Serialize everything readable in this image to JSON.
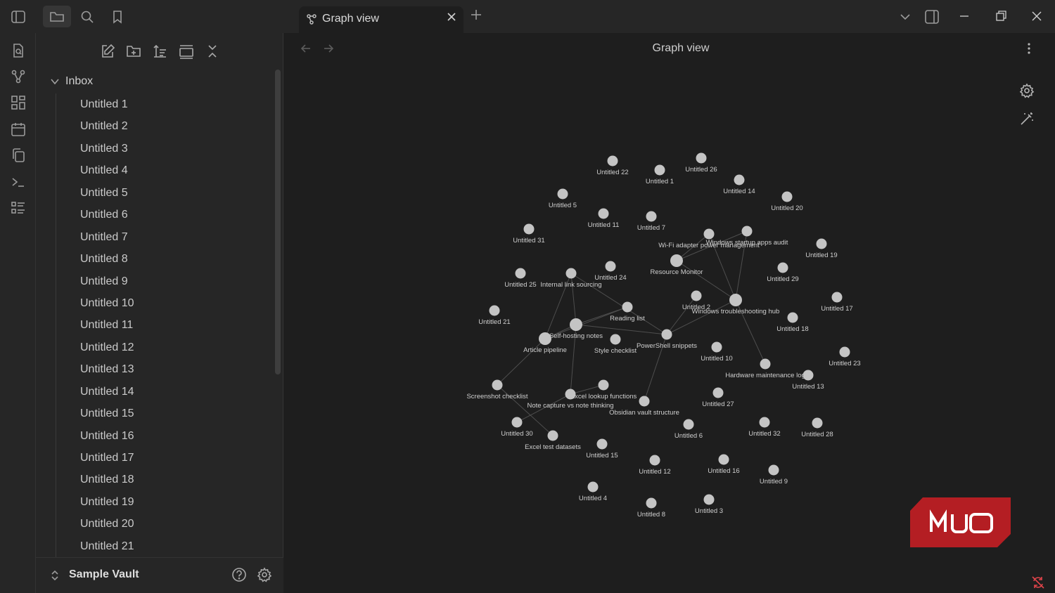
{
  "app": {
    "tab_title": "Graph view",
    "view_title": "Graph view"
  },
  "sidebar": {
    "folder_name": "Inbox",
    "files": [
      "Untitled 1",
      "Untitled 2",
      "Untitled 3",
      "Untitled 4",
      "Untitled 5",
      "Untitled 6",
      "Untitled 7",
      "Untitled 8",
      "Untitled 9",
      "Untitled 10",
      "Untitled 11",
      "Untitled 12",
      "Untitled 13",
      "Untitled 14",
      "Untitled 15",
      "Untitled 16",
      "Untitled 17",
      "Untitled 18",
      "Untitled 19",
      "Untitled 20",
      "Untitled 21"
    ],
    "vault_name": "Sample Vault"
  },
  "graph": {
    "nodes": [
      {
        "label": "Untitled 22"
      },
      {
        "label": "Untitled 26"
      },
      {
        "label": "Untitled 1"
      },
      {
        "label": "Untitled 14"
      },
      {
        "label": "Untitled 20"
      },
      {
        "label": "Untitled 5"
      },
      {
        "label": "Untitled 11"
      },
      {
        "label": "Untitled 7"
      },
      {
        "label": "Untitled 31"
      },
      {
        "label": "Wi-Fi adapter power management"
      },
      {
        "label": "Windows startup apps audit"
      },
      {
        "label": "Untitled 19"
      },
      {
        "label": "Resource Monitor"
      },
      {
        "label": "Untitled 29"
      },
      {
        "label": "Untitled 25"
      },
      {
        "label": "Internal link sourcing"
      },
      {
        "label": "Untitled 24"
      },
      {
        "label": "Untitled 2"
      },
      {
        "label": "Windows troubleshooting hub"
      },
      {
        "label": "Untitled 17"
      },
      {
        "label": "Untitled 21"
      },
      {
        "label": "Reading list"
      },
      {
        "label": "Untitled 18"
      },
      {
        "label": "Self-hosting notes"
      },
      {
        "label": "Article pipeline"
      },
      {
        "label": "Style checklist"
      },
      {
        "label": "PowerShell snippets"
      },
      {
        "label": "Untitled 10"
      },
      {
        "label": "Untitled 23"
      },
      {
        "label": "Hardware maintenance log"
      },
      {
        "label": "Untitled 13"
      },
      {
        "label": "Screenshot checklist"
      },
      {
        "label": "Excel lookup functions"
      },
      {
        "label": "Note capture vs note thinking"
      },
      {
        "label": "Obsidian vault structure"
      },
      {
        "label": "Untitled 27"
      },
      {
        "label": "Untitled 30"
      },
      {
        "label": "Untitled 6"
      },
      {
        "label": "Untitled 32"
      },
      {
        "label": "Untitled 28"
      },
      {
        "label": "Excel test datasets"
      },
      {
        "label": "Untitled 15"
      },
      {
        "label": "Untitled 12"
      },
      {
        "label": "Untitled 16"
      },
      {
        "label": "Untitled 9"
      },
      {
        "label": "Untitled 4"
      },
      {
        "label": "Untitled 8"
      },
      {
        "label": "Untitled 3"
      }
    ]
  },
  "watermark": {
    "text": "MUO",
    "color": "#b41e23"
  },
  "colors": {
    "accent_red": "#e0444a",
    "node": "#c4c4c4",
    "background": "#1e1e1e",
    "panel": "#262626"
  }
}
